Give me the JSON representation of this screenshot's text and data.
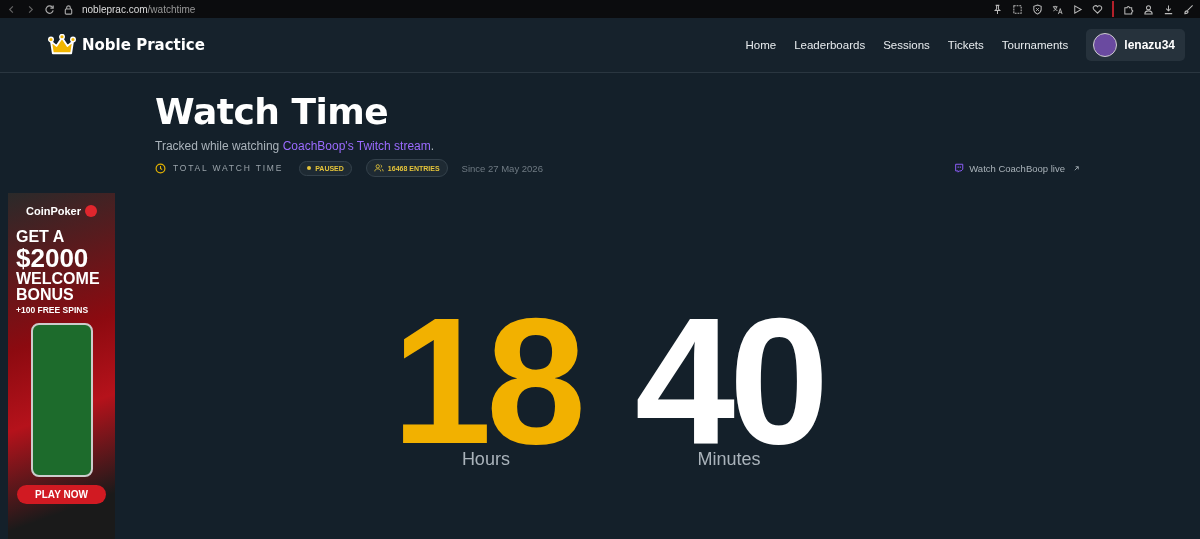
{
  "browser": {
    "url_host": "nobleprac.com",
    "url_path": "/watchtime"
  },
  "nav": {
    "brand": "Noble Practice",
    "links": [
      {
        "label": "Home"
      },
      {
        "label": "Leaderboards"
      },
      {
        "label": "Sessions"
      },
      {
        "label": "Tickets"
      },
      {
        "label": "Tournaments"
      }
    ],
    "user": "lenazu34"
  },
  "header": {
    "title": "Watch Time",
    "subtitle_prefix": "Tracked while watching ",
    "subtitle_link": "CoachBoop's Twitch stream",
    "subtitle_suffix": ".",
    "meta_label": "TOTAL WATCH TIME",
    "status": "PAUSED",
    "entries": "16468 ENTRIES",
    "since": "Since 27 May 2026",
    "live_link": "Watch CoachBoop live"
  },
  "ad": {
    "brand": "CoinPoker",
    "headline": [
      "GET A",
      "$2000",
      "WELCOME",
      "BONUS"
    ],
    "subline": "+100 FREE SPINS",
    "cta": "PLAY NOW"
  },
  "counter": [
    {
      "value": "18",
      "label": "Hours",
      "kind": "accent"
    },
    {
      "value": "40",
      "label": "Minutes",
      "kind": "plain"
    }
  ]
}
